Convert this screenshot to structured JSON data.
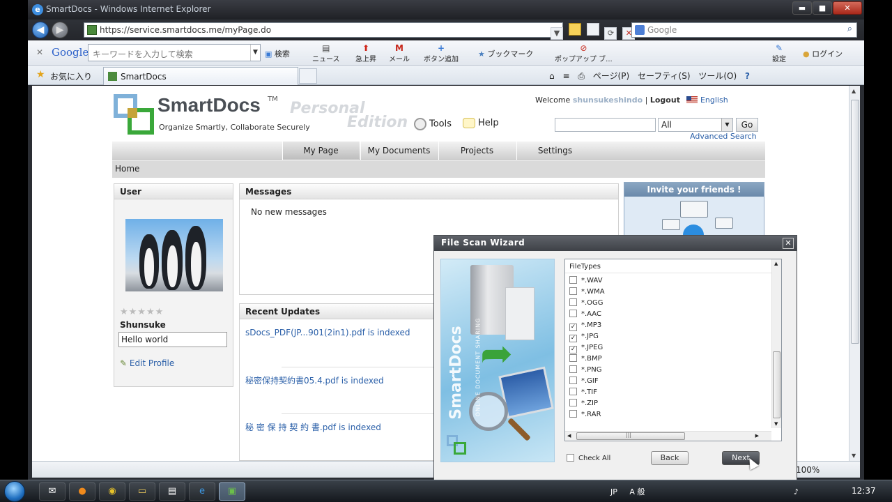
{
  "window": {
    "title": "SmartDocs - Windows Internet Explorer",
    "min": "▬",
    "max": "■",
    "close": "✕"
  },
  "address": {
    "url": "https://service.smartdocs.me/myPage.do",
    "search_placeholder": "Google"
  },
  "gtoolbar": {
    "logo": "Google",
    "placeholder": "キーワードを入力して検索",
    "search": "検索",
    "news": "ニュース",
    "rising": "急上昇",
    "mail": "メール",
    "add_button": "ボタン追加",
    "bookmarks": "ブックマーク",
    "popup": "ポップアップ ブ...",
    "settings": "設定",
    "login": "ログイン"
  },
  "favbar": {
    "favorites": "お気に入り",
    "tab_title": "SmartDocs",
    "page": "ページ(P)",
    "safety": "セーフティ(S)",
    "tools": "ツール(O)"
  },
  "site": {
    "name": "SmartDocs",
    "tm": "TM",
    "tagline": "Organize Smartly, Collaborate Securely",
    "edition_1": "Personal",
    "edition_2": "Edition",
    "tools": "Tools",
    "help": "Help",
    "welcome": "Welcome",
    "username": "shunsukeshindo",
    "sep": "|",
    "logout": "Logout",
    "language": "English",
    "search_scope": "All",
    "go": "Go",
    "advanced": "Advanced Search"
  },
  "nav": {
    "tabs": [
      "My Page",
      "My Documents",
      "Projects",
      "Settings"
    ]
  },
  "breadcrumb": "Home",
  "user_panel": {
    "title": "User",
    "stars": "★★★★★",
    "name": "Shunsuke",
    "status": "Hello world",
    "edit": "Edit Profile"
  },
  "messages": {
    "title": "Messages",
    "empty": "No new messages"
  },
  "updates": {
    "title": "Recent Updates",
    "items": [
      "sDocs_PDF(JP...901(2in1).pdf is indexed",
      "秘密保持契約書05.4.pdf is indexed",
      "秘 密 保 持 契 約 書.pdf is indexed"
    ]
  },
  "invite": {
    "title": "Invite your friends !"
  },
  "dialog": {
    "title": "File Scan Wizard",
    "art_brand": "SmartDocs",
    "art_sub": "ONLINE DOCUMENT SHARING",
    "list_header": "FileTypes",
    "scroll_grip": "|||",
    "files": [
      {
        "ext": "*.WAV",
        "checked": false
      },
      {
        "ext": "*.WMA",
        "checked": false
      },
      {
        "ext": "*.OGG",
        "checked": false
      },
      {
        "ext": "*.AAC",
        "checked": false
      },
      {
        "ext": "*.MP3",
        "checked": true
      },
      {
        "ext": "*.JPG",
        "checked": true
      },
      {
        "ext": "*.JPEG",
        "checked": true
      },
      {
        "ext": "*.BMP",
        "checked": false
      },
      {
        "ext": "*.PNG",
        "checked": false
      },
      {
        "ext": "*.GIF",
        "checked": false
      },
      {
        "ext": "*.TIF",
        "checked": false
      },
      {
        "ext": "*.ZIP",
        "checked": false
      },
      {
        "ext": "*.RAR",
        "checked": false
      }
    ],
    "check_all": "Check All",
    "back": "Back",
    "next": "Next"
  },
  "statusbar": {
    "zoom": "100%"
  },
  "taskbar": {
    "ime": "JP",
    "ime_mode": "A 般",
    "clock": "12:37"
  },
  "icons": {
    "star": "★",
    "checkmark": "✓",
    "dropdown": "▼",
    "up": "▲",
    "down": "▼",
    "left": "◀",
    "right": "▶",
    "close": "✕",
    "back_arrow": "◀",
    "fwd_arrow": "▶",
    "search": "⌕",
    "refresh": "⟳",
    "feed": "≡",
    "home": "⌂",
    "print": "⎙",
    "help": "?"
  }
}
